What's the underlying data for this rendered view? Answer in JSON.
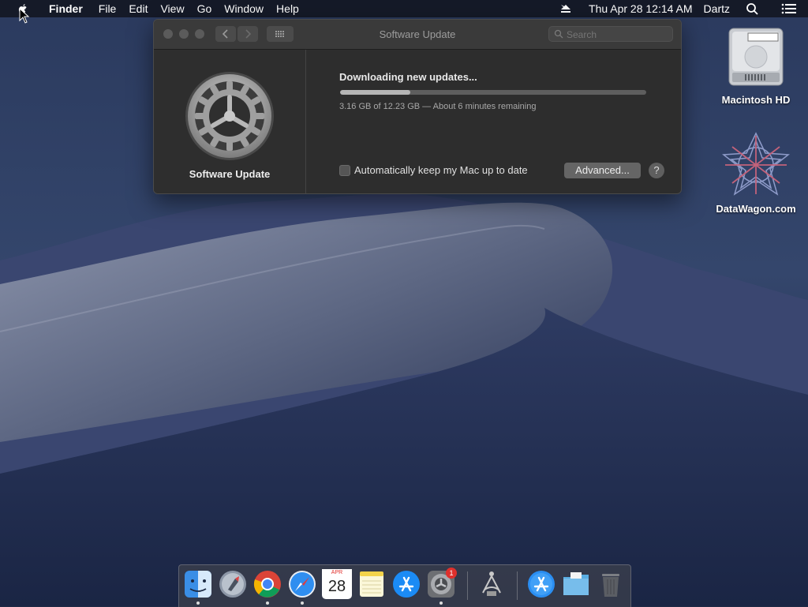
{
  "menubar": {
    "app_name": "Finder",
    "menus": [
      "File",
      "Edit",
      "View",
      "Go",
      "Window",
      "Help"
    ],
    "clock": "Thu Apr 28  12:14 AM",
    "user": "Dartz",
    "icons": [
      "apple-icon",
      "eject-icon",
      "spotlight-icon",
      "notification-list-icon"
    ]
  },
  "window": {
    "title": "Software Update",
    "search_placeholder": "Search",
    "sidebar_label": "Software Update",
    "status_title": "Downloading new updates...",
    "progress_fraction": 0.23,
    "progress_detail": "3.16 GB of 12.23 GB — About 6 minutes remaining",
    "auto_update_label": "Automatically keep my Mac up to date",
    "auto_update_checked": false,
    "advanced_label": "Advanced...",
    "help_label": "?"
  },
  "desktop": {
    "icons": [
      {
        "label": "Macintosh HD",
        "icon": "hard-drive-icon"
      },
      {
        "label": "DataWagon.com",
        "icon": "datawagon-logo-icon"
      }
    ]
  },
  "dock": {
    "calendar_month": "APR",
    "calendar_day": "28",
    "badge_count": "1",
    "items": [
      "finder",
      "launchpad",
      "chrome",
      "safari",
      "calendar",
      "notes",
      "app-store",
      "system-preferences",
      "utility",
      "app-store-folder",
      "documents-folder",
      "trash"
    ]
  },
  "colors": {
    "window_bg": "#2d2d2d",
    "progress_fill": "#b5b5b5",
    "badge": "#e0302c"
  }
}
